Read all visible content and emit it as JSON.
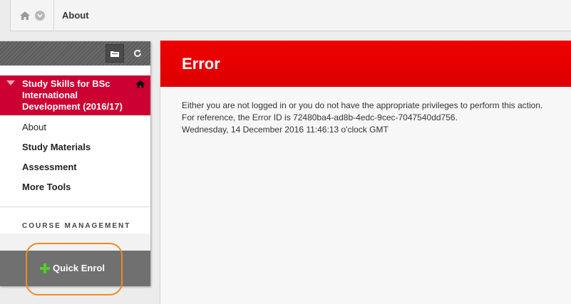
{
  "breadcrumb": {
    "current": "About"
  },
  "course_menu": {
    "course_title": "Study Skills for BSc International Development (2016/17)",
    "items": [
      {
        "label": "About",
        "bold": false
      },
      {
        "label": "Study Materials",
        "bold": true
      },
      {
        "label": "Assessment",
        "bold": true
      },
      {
        "label": "More Tools",
        "bold": true
      }
    ],
    "section_label": "COURSE MANAGEMENT",
    "quick_enrol_label": "Quick Enrol"
  },
  "error": {
    "title": "Error",
    "lines": [
      "Either you are not logged in or you do not have the appropriate privileges to perform this action.",
      "For reference, the Error ID is 72480ba4-ad8b-4edc-9cec-7047540dd756.",
      "Wednesday, 14 December 2016 11:46:13 o'clock GMT"
    ]
  },
  "icons": {
    "home": "home-icon",
    "breadcrumb_menu": "chevron-down-icon",
    "folder": "folder-icon",
    "refresh": "refresh-icon",
    "course_home": "house-icon",
    "expand": "triangle-down-icon",
    "add": "plus-icon"
  },
  "colors": {
    "course_title_bg": "#cc0033",
    "error_header_bg": "#ee0000",
    "quick_enrol_band": "#707070",
    "highlight_ring": "#f08a24",
    "plus_icon": "#55cc22"
  }
}
